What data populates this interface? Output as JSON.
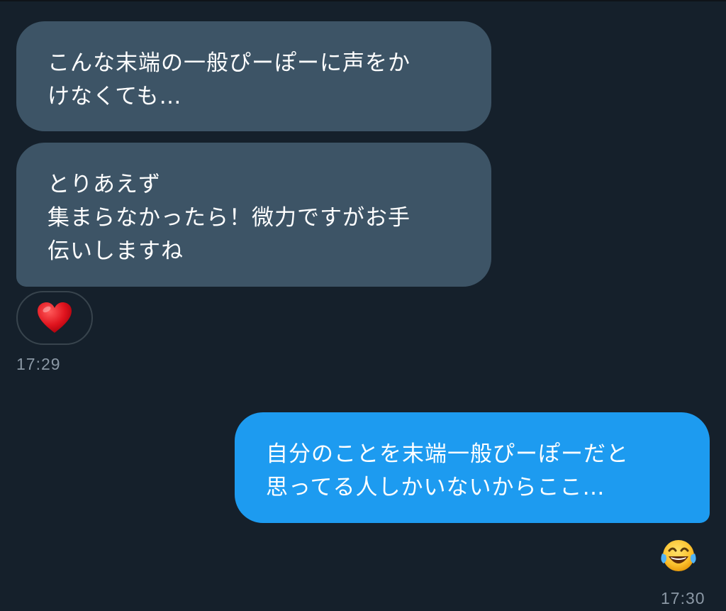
{
  "messages": [
    {
      "direction": "received",
      "text": "こんな末端の一般ぴーぽーに声をか\nけなくても…"
    },
    {
      "direction": "received",
      "text": "とりあえず\n集まらなかったら！微力ですがお手\n伝いしますね",
      "reaction": "heart-emoji",
      "timestamp": "17:29"
    },
    {
      "direction": "sent",
      "text": "自分のことを末端一般ぴーぽーだと\n思ってる人しかいないからここ…",
      "reaction": "face-with-tears-of-joy-emoji",
      "timestamp": "17:30"
    }
  ],
  "colors": {
    "background": "#15202b",
    "received_bubble": "#3d5466",
    "sent_bubble": "#1d9bf0",
    "timestamp": "#8b98a5",
    "reaction_border": "#38444d"
  }
}
